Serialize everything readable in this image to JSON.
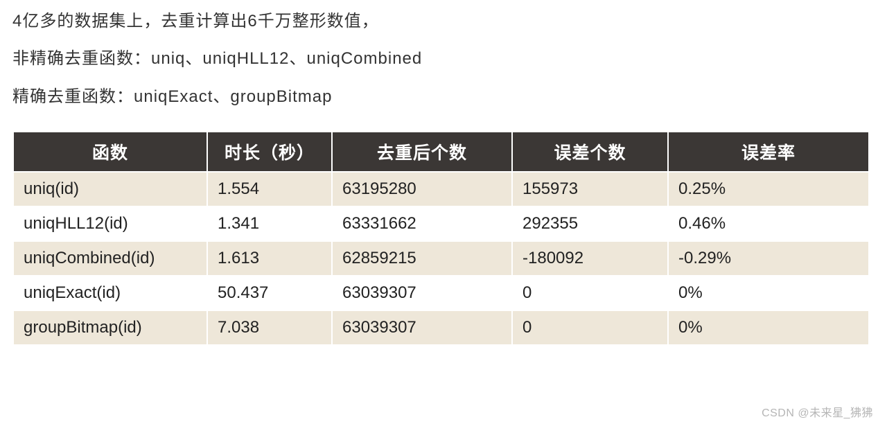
{
  "paragraphs": {
    "p1": "4亿多的数据集上，去重计算出6千万整形数值，",
    "p2": "非精确去重函数：uniq、uniqHLL12、uniqCombined",
    "p3": "精确去重函数：uniqExact、groupBitmap"
  },
  "table": {
    "headers": {
      "func": "函数",
      "duration": "时长（秒）",
      "distinct": "去重后个数",
      "error_count": "误差个数",
      "error_rate": "误差率"
    },
    "rows": [
      {
        "func": "uniq(id)",
        "duration": "1.554",
        "distinct": "63195280",
        "error_count": "155973",
        "error_rate": "0.25%"
      },
      {
        "func": "uniqHLL12(id)",
        "duration": "1.341",
        "distinct": "63331662",
        "error_count": "292355",
        "error_rate": "0.46%"
      },
      {
        "func": "uniqCombined(id)",
        "duration": "1.613",
        "distinct": "62859215",
        "error_count": "-180092",
        "error_rate": "-0.29%"
      },
      {
        "func": "uniqExact(id)",
        "duration": "50.437",
        "distinct": "63039307",
        "error_count": "0",
        "error_rate": "0%"
      },
      {
        "func": "groupBitmap(id)",
        "duration": "7.038",
        "distinct": "63039307",
        "error_count": "0",
        "error_rate": "0%"
      }
    ]
  },
  "watermark": "CSDN @未来星_狒狒"
}
